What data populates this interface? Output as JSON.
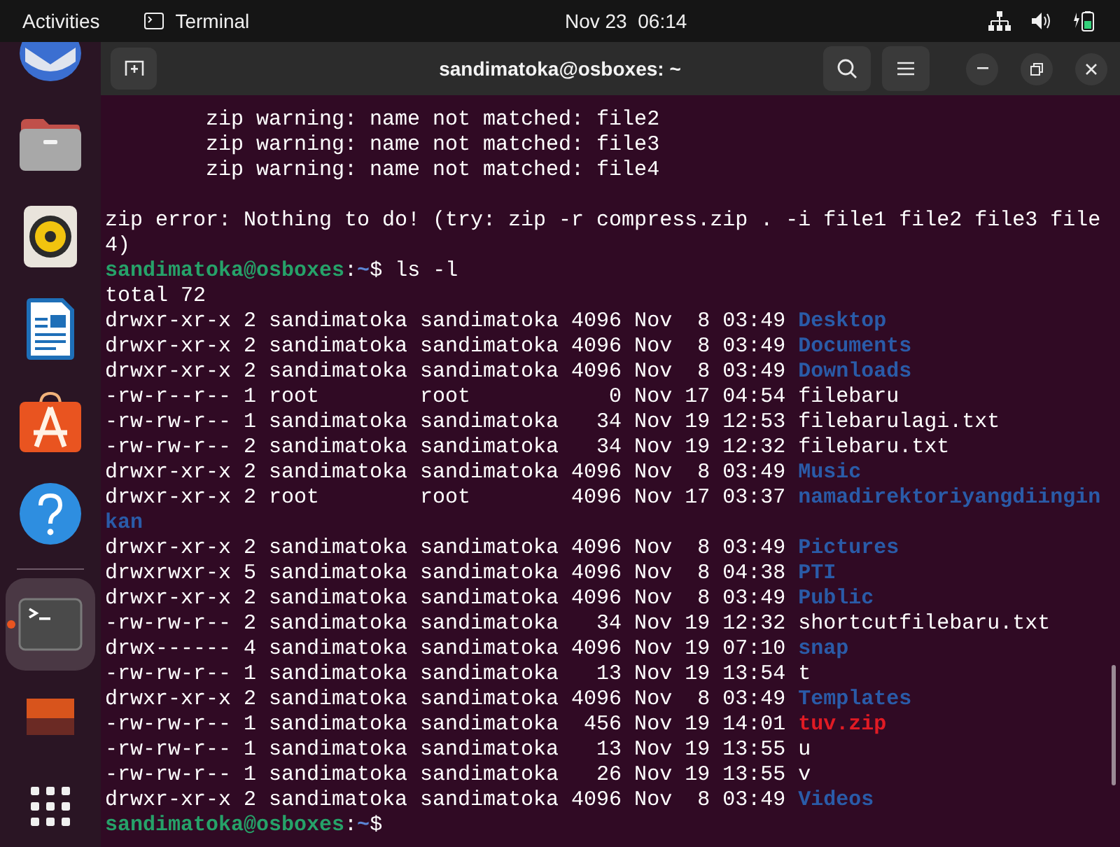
{
  "top_bar": {
    "activities": "Activities",
    "app_name": "Terminal",
    "clock": "Nov 23  06:14"
  },
  "dock": {
    "items": [
      {
        "kind": "mail",
        "selected": false,
        "running": false
      },
      {
        "kind": "files",
        "selected": false,
        "running": false
      },
      {
        "kind": "music",
        "selected": false,
        "running": false
      },
      {
        "kind": "writer",
        "selected": false,
        "running": false
      },
      {
        "kind": "store",
        "selected": false,
        "running": false
      },
      {
        "kind": "help",
        "selected": false,
        "running": false
      },
      {
        "kind": "separator"
      },
      {
        "kind": "terminal",
        "selected": true,
        "running": true
      },
      {
        "kind": "thumbnail",
        "selected": false,
        "running": false
      },
      {
        "kind": "grid",
        "selected": false,
        "running": false
      }
    ]
  },
  "window": {
    "title": "sandimatoka@osboxes: ~"
  },
  "terminal": {
    "lines": [
      {
        "kind": "text",
        "segments": [
          {
            "text": "        zip warning: name not matched: file2",
            "kind": "plain"
          }
        ]
      },
      {
        "kind": "text",
        "segments": [
          {
            "text": "        zip warning: name not matched: file3",
            "kind": "plain"
          }
        ]
      },
      {
        "kind": "text",
        "segments": [
          {
            "text": "        zip warning: name not matched: file4",
            "kind": "plain"
          }
        ]
      },
      {
        "kind": "blank"
      },
      {
        "kind": "text",
        "segments": [
          {
            "text": "zip error: Nothing to do! (try: zip -r compress.zip . -i file1 file2 file3 file",
            "kind": "plain"
          }
        ]
      },
      {
        "kind": "text",
        "segments": [
          {
            "text": "4)",
            "kind": "plain"
          }
        ]
      },
      {
        "kind": "text",
        "segments": [
          {
            "text": "sandimatoka@osboxes",
            "kind": "user"
          },
          {
            "text": ":",
            "kind": "plain"
          },
          {
            "text": "~",
            "kind": "path"
          },
          {
            "text": "$ ls -l",
            "kind": "plain"
          }
        ]
      },
      {
        "kind": "text",
        "segments": [
          {
            "text": "total 72",
            "kind": "plain"
          }
        ]
      },
      {
        "kind": "text",
        "segments": [
          {
            "text": "drwxr-xr-x 2 sandimatoka sandimatoka 4096 Nov  8 03:49",
            "kind": "plain"
          },
          {
            "text": "Desktop",
            "kind": "dir"
          }
        ]
      },
      {
        "kind": "text",
        "segments": [
          {
            "text": "drwxr-xr-x 2 sandimatoka sandimatoka 4096 Nov  8 03:49",
            "kind": "plain"
          },
          {
            "text": "Documents",
            "kind": "dir"
          }
        ]
      },
      {
        "kind": "text",
        "segments": [
          {
            "text": "drwxr-xr-x 2 sandimatoka sandimatoka 4096 Nov  8 03:49",
            "kind": "plain"
          },
          {
            "text": "Downloads",
            "kind": "dir"
          }
        ]
      },
      {
        "kind": "text",
        "segments": [
          {
            "text": "-rw-r--r-- 1 root        root           0 Nov 17 04:54",
            "kind": "plain"
          },
          {
            "text": "filebaru",
            "kind": "plain"
          }
        ]
      },
      {
        "kind": "text",
        "segments": [
          {
            "text": "-rw-rw-r-- 1 sandimatoka sandimatoka   34 Nov 19 12:53",
            "kind": "plain"
          },
          {
            "text": "filebarulagi.txt",
            "kind": "plain"
          }
        ]
      },
      {
        "kind": "text",
        "segments": [
          {
            "text": "-rw-rw-r-- 2 sandimatoka sandimatoka   34 Nov 19 12:32",
            "kind": "plain"
          },
          {
            "text": "filebaru.txt",
            "kind": "plain"
          }
        ]
      },
      {
        "kind": "text",
        "segments": [
          {
            "text": "drwxr-xr-x 2 sandimatoka sandimatoka 4096 Nov  8 03:49",
            "kind": "plain"
          },
          {
            "text": "Music",
            "kind": "dir"
          }
        ]
      },
      {
        "kind": "text",
        "segments": [
          {
            "text": "drwxr-xr-x 2 root        root        4096 Nov 17 03:37",
            "kind": "plain"
          },
          {
            "text": "namadirektoriyangdiingin",
            "kind": "dir"
          }
        ]
      },
      {
        "kind": "text",
        "segments": [
          {
            "text": "kan",
            "kind": "dir"
          }
        ]
      },
      {
        "kind": "text",
        "segments": [
          {
            "text": "drwxr-xr-x 2 sandimatoka sandimatoka 4096 Nov  8 03:49",
            "kind": "plain"
          },
          {
            "text": "Pictures",
            "kind": "dir"
          }
        ]
      },
      {
        "kind": "text",
        "segments": [
          {
            "text": "drwxrwxr-x 5 sandimatoka sandimatoka 4096 Nov  8 04:38",
            "kind": "plain"
          },
          {
            "text": "PTI",
            "kind": "dir"
          }
        ]
      },
      {
        "kind": "text",
        "segments": [
          {
            "text": "drwxr-xr-x 2 sandimatoka sandimatoka 4096 Nov  8 03:49",
            "kind": "plain"
          },
          {
            "text": "Public",
            "kind": "dir"
          }
        ]
      },
      {
        "kind": "text",
        "segments": [
          {
            "text": "-rw-rw-r-- 2 sandimatoka sandimatoka   34 Nov 19 12:32",
            "kind": "plain"
          },
          {
            "text": "shortcutfilebaru.txt",
            "kind": "plain"
          }
        ]
      },
      {
        "kind": "text",
        "segments": [
          {
            "text": "drwx------ 4 sandimatoka sandimatoka 4096 Nov 19 07:10",
            "kind": "plain"
          },
          {
            "text": "snap",
            "kind": "dir"
          }
        ]
      },
      {
        "kind": "text",
        "segments": [
          {
            "text": "-rw-rw-r-- 1 sandimatoka sandimatoka   13 Nov 19 13:54",
            "kind": "plain"
          },
          {
            "text": "t",
            "kind": "plain"
          }
        ]
      },
      {
        "kind": "text",
        "segments": [
          {
            "text": "drwxr-xr-x 2 sandimatoka sandimatoka 4096 Nov  8 03:49",
            "kind": "plain"
          },
          {
            "text": "Templates",
            "kind": "dir"
          }
        ]
      },
      {
        "kind": "text",
        "segments": [
          {
            "text": "-rw-rw-r-- 1 sandimatoka sandimatoka  456 Nov 19 14:01",
            "kind": "plain"
          },
          {
            "text": "tuv.zip",
            "kind": "archive"
          }
        ]
      },
      {
        "kind": "text",
        "segments": [
          {
            "text": "-rw-rw-r-- 1 sandimatoka sandimatoka   13 Nov 19 13:55",
            "kind": "plain"
          },
          {
            "text": "u",
            "kind": "plain"
          }
        ]
      },
      {
        "kind": "text",
        "segments": [
          {
            "text": "-rw-rw-r-- 1 sandimatoka sandimatoka   26 Nov 19 13:55",
            "kind": "plain"
          },
          {
            "text": "v",
            "kind": "plain"
          }
        ]
      },
      {
        "kind": "text",
        "segments": [
          {
            "text": "drwxr-xr-x 2 sandimatoka sandimatoka 4096 Nov  8 03:49",
            "kind": "plain"
          },
          {
            "text": "Videos",
            "kind": "dir"
          }
        ]
      },
      {
        "kind": "text",
        "segments": [
          {
            "text": "sandimatoka@osboxes",
            "kind": "user"
          },
          {
            "text": ":",
            "kind": "plain"
          },
          {
            "text": "~",
            "kind": "path"
          },
          {
            "text": "$",
            "kind": "plain"
          }
        ]
      }
    ]
  }
}
